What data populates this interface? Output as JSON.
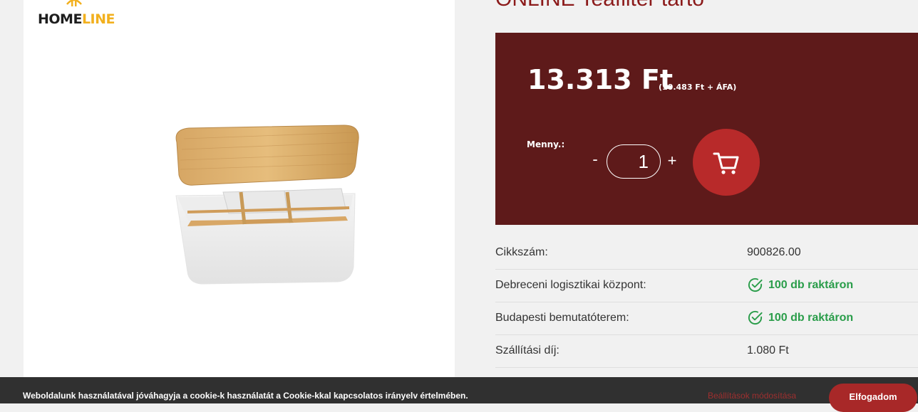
{
  "brand": {
    "logo_home": "HOME",
    "logo_line": "LINE"
  },
  "product": {
    "title": "ONLINE Teafilter tartó",
    "image_icon": "tea-box-with-bamboo-lid"
  },
  "price": {
    "gross": "13.313 Ft",
    "net": "(10.483 Ft + ÁFA)",
    "quantity_label": "Menny.:",
    "minus": "-",
    "quantity_value": "1",
    "plus": "+",
    "cart_icon": "shopping-cart-icon"
  },
  "specs": [
    {
      "label": "Cikkszám:",
      "value": "900826.00"
    },
    {
      "label": "Debreceni logisztikai központ:",
      "value": "100 db raktáron"
    },
    {
      "label": "Budapesti bemutatóterem:",
      "value": "100 db raktáron"
    },
    {
      "label": "Szállítási díj:",
      "value": "1.080 Ft"
    }
  ],
  "cookie": {
    "text": "Weboldalunk használatával jóváhagyja a cookie-k használatát a Cookie-kkal kapcsolatos irányelv értelmében.",
    "settings_label": "Beállítások módosítása",
    "accept_label": "Elfogadom"
  },
  "colors": {
    "brand_dark_red": "#5e1a1a",
    "accent_red": "#b82a2a",
    "stock_green": "#2a9d4a",
    "logo_yellow": "#f2b01e"
  }
}
